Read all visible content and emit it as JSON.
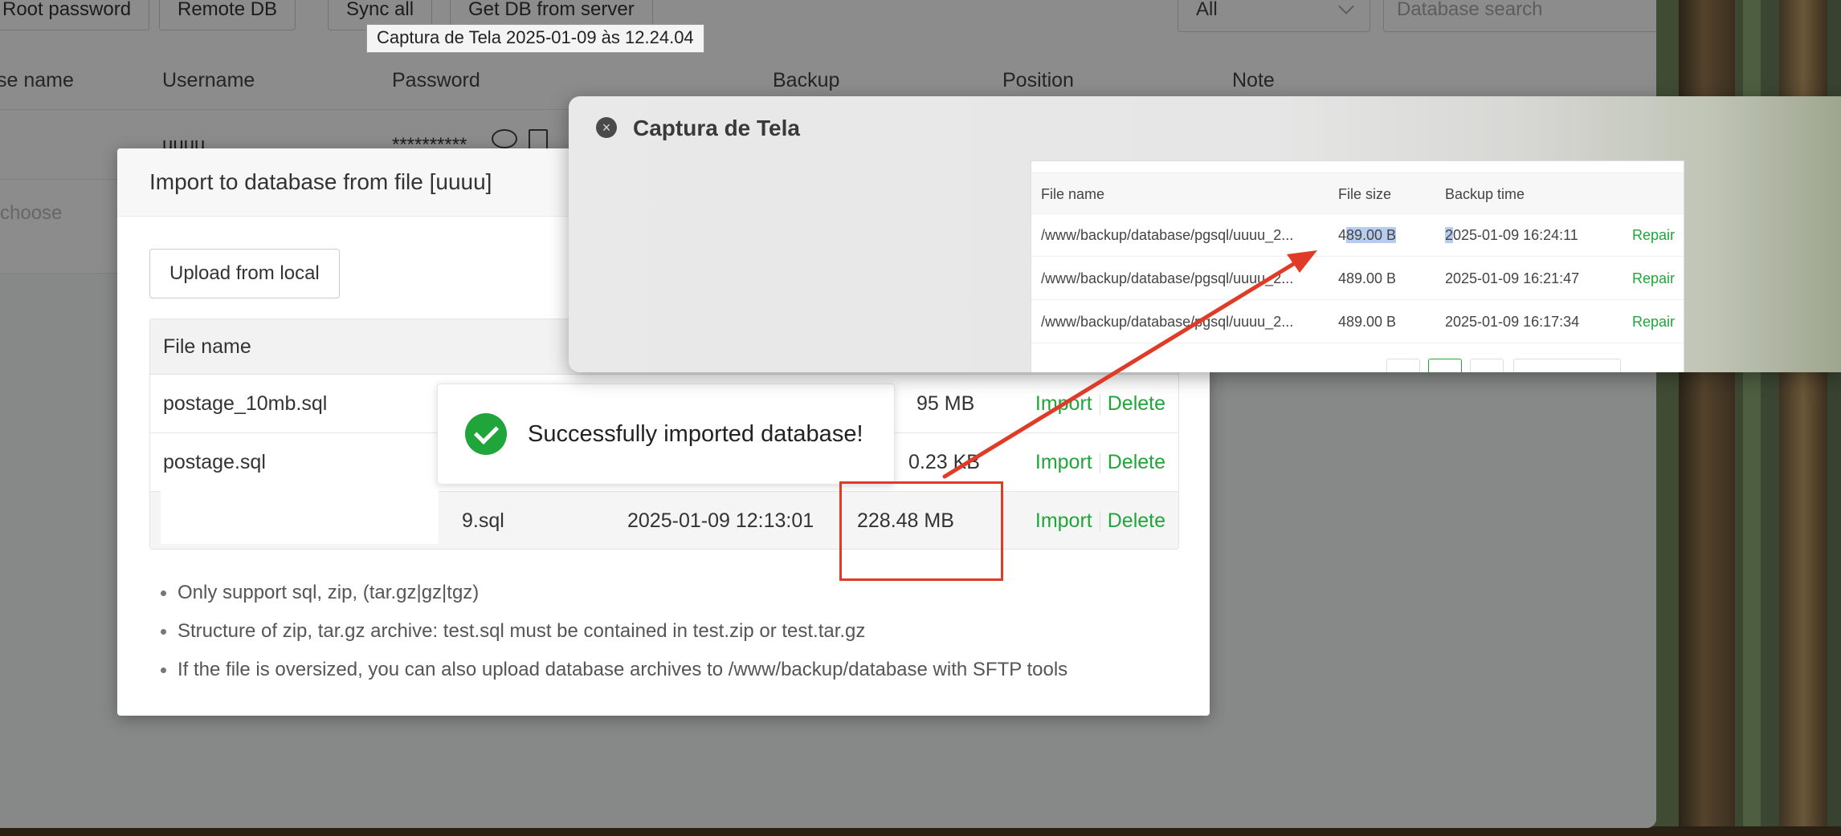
{
  "toolbar": {
    "buttons": [
      "Root password",
      "Remote DB",
      "Sync all",
      "Get DB from server"
    ],
    "filter_value": "All",
    "search_placeholder": "Database search"
  },
  "tooltip": "Captura de Tela 2025-01-09 às 12.24.04",
  "db_table": {
    "columns": [
      "se name",
      "Username",
      "Password",
      "Backup",
      "Position",
      "Note"
    ],
    "row": {
      "username": "uuuu",
      "password": "**********"
    },
    "choose_placeholder": "choose"
  },
  "modal": {
    "title": "Import to database from file [uuuu]",
    "upload_label": "Upload from local",
    "file_name_header": "File name",
    "files": [
      {
        "name": "postage_10mb.sql",
        "date": "",
        "size": "95 MB"
      },
      {
        "name": "postage.sql",
        "date": "",
        "size": "0.23 KB"
      },
      {
        "name": "9.sql",
        "date": "2025-01-09 12:13:01",
        "size": "228.48 MB"
      }
    ],
    "import_label": "Import",
    "delete_label": "Delete",
    "tips": [
      "Only support sql, zip, (tar.gz|gz|tgz)",
      "Structure of zip, tar.gz archive: test.sql must be contained in test.zip or test.tar.gz",
      "If the file is oversized, you can also upload database archives to /www/backup/database with SFTP tools"
    ]
  },
  "toast": {
    "message": "Successfully imported database!"
  },
  "viewer": {
    "title": "Captura de Tela",
    "columns": [
      "File name",
      "File size",
      "Backup time"
    ],
    "rows": [
      {
        "file": "/www/backup/database/pgsql/uuuu_2...",
        "size_prefix": "4",
        "size_hl": "89.00 B",
        "time_hl": "2",
        "time_rest": "025-01-09 16:24:11",
        "action": "Repair"
      },
      {
        "file": "/www/backup/database/pgsql/uuuu_2...",
        "size": "489.00 B",
        "time": "2025-01-09 16:21:47",
        "action": "Repair"
      },
      {
        "file": "/www/backup/database/pgsql/uuuu_2...",
        "size": "489.00 B",
        "time": "2025-01-09 16:17:34",
        "action": "Repair"
      }
    ]
  },
  "colors": {
    "accent_green": "#20a53a",
    "highlight_red": "#e03b26",
    "selection_blue": "#b7cdf0"
  }
}
